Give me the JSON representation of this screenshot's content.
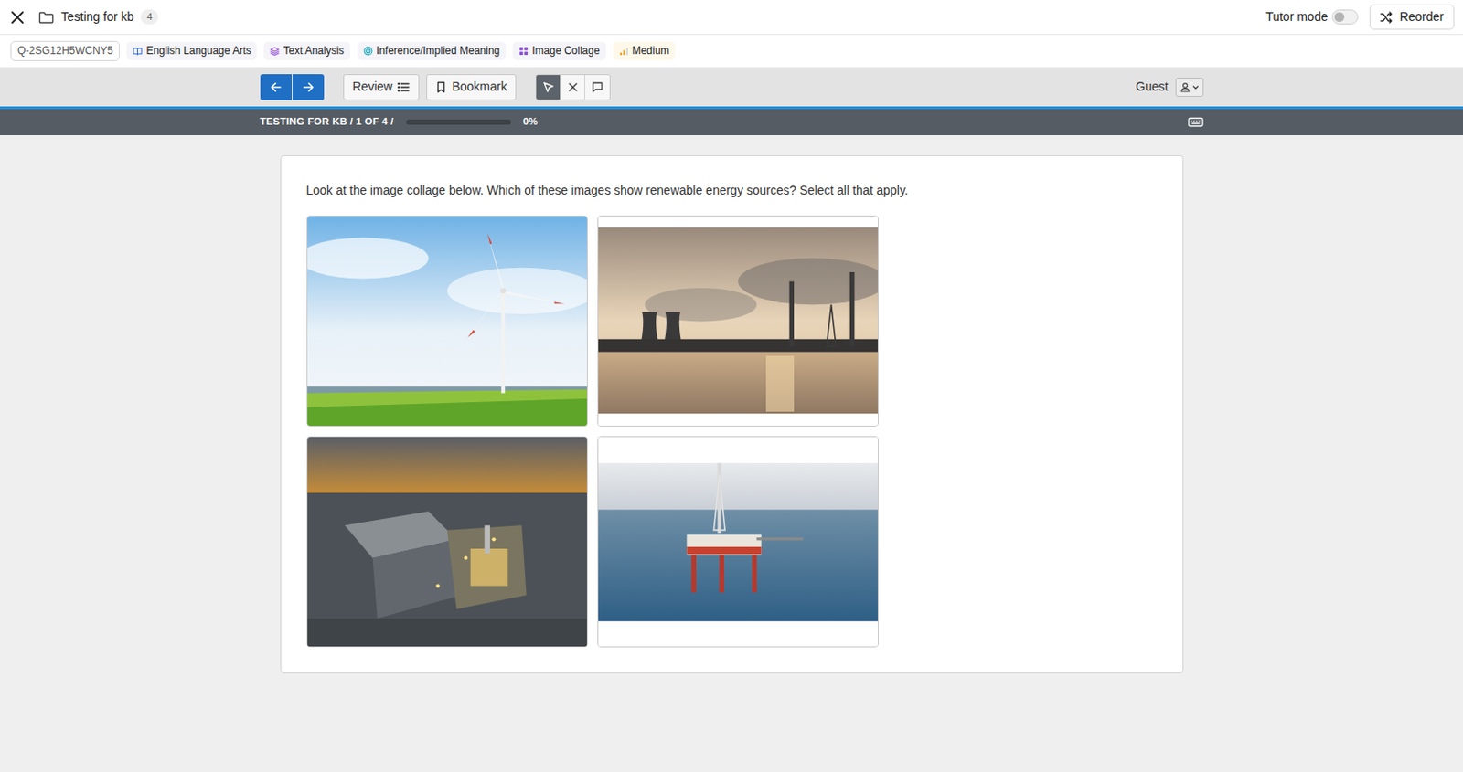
{
  "top_bar": {
    "title": "Testing for kb",
    "count": "4",
    "tutor_mode": {
      "label": "Tutor mode",
      "on": false
    },
    "reorder": "Reorder"
  },
  "tags": [
    {
      "label": "Q-2SG12H5WCNY5",
      "kind": "id"
    },
    {
      "label": "English Language Arts",
      "kind": "subject"
    },
    {
      "label": "Text Analysis",
      "kind": "topic"
    },
    {
      "label": "Inference/Implied Meaning",
      "kind": "skill"
    },
    {
      "label": "Image Collage",
      "kind": "type"
    },
    {
      "label": "Medium",
      "kind": "difficulty"
    }
  ],
  "toolbar": {
    "nav": [
      {
        "kind": "prev"
      },
      {
        "kind": "next"
      }
    ],
    "review": "Review",
    "bookmark": "Bookmark",
    "tools": [
      {
        "kind": "pointer",
        "selected": true
      },
      {
        "kind": "eliminate",
        "selected": false
      },
      {
        "kind": "comment",
        "selected": false
      }
    ],
    "user": "Guest"
  },
  "progress": {
    "label": "TESTING FOR KB / 1 OF 4 /",
    "level": 0,
    "reading": "0%"
  },
  "question": {
    "text": "Look at the image collage below. Which of these images show renewable energy sources? Select all that apply.",
    "options": [
      {
        "kind": "wind",
        "selected": false
      },
      {
        "kind": "powerplant",
        "selected": false
      },
      {
        "kind": "factory",
        "selected": false
      },
      {
        "kind": "oilrig",
        "selected": false
      }
    ]
  }
}
